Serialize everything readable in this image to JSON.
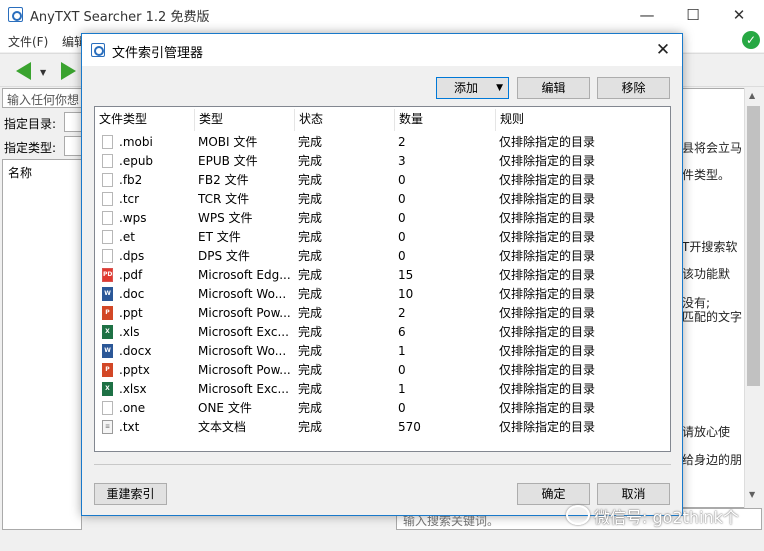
{
  "main": {
    "title": "AnyTXT Searcher 1.2 免费版",
    "window_buttons": [
      "—",
      "☐",
      "✕"
    ],
    "menu": [
      "文件(F)",
      "编辑"
    ],
    "search_placeholder": "输入任何你想",
    "dir_label": "指定目录:",
    "type_label": "指定类型:",
    "name_header": "名称",
    "right_snippets": [
      "县将会立马",
      "件类型。",
      "T开搜索软",
      "该功能默",
      "没有;",
      "匹配的文字",
      "请放心使",
      "给身边的朋"
    ],
    "bottom_input": "输入搜索关键词。",
    "status_icon": "check-icon"
  },
  "dialog": {
    "title": "文件索引管理器",
    "close_glyph": "✕",
    "add_label": "添加",
    "edit_label": "编辑",
    "remove_label": "移除",
    "rebuild_label": "重建索引",
    "ok_label": "确定",
    "cancel_label": "取消",
    "columns": [
      "文件类型",
      "类型",
      "状态",
      "数量",
      "规则"
    ],
    "rows": [
      {
        "ext": ".mobi",
        "type": "MOBI 文件",
        "status": "完成",
        "count": "2",
        "rule": "仅排除指定的目录",
        "icon": "blank"
      },
      {
        "ext": ".epub",
        "type": "EPUB 文件",
        "status": "完成",
        "count": "3",
        "rule": "仅排除指定的目录",
        "icon": "blank"
      },
      {
        "ext": ".fb2",
        "type": "FB2 文件",
        "status": "完成",
        "count": "0",
        "rule": "仅排除指定的目录",
        "icon": "blank"
      },
      {
        "ext": ".tcr",
        "type": "TCR 文件",
        "status": "完成",
        "count": "0",
        "rule": "仅排除指定的目录",
        "icon": "blank"
      },
      {
        "ext": ".wps",
        "type": "WPS 文件",
        "status": "完成",
        "count": "0",
        "rule": "仅排除指定的目录",
        "icon": "blank"
      },
      {
        "ext": ".et",
        "type": "ET 文件",
        "status": "完成",
        "count": "0",
        "rule": "仅排除指定的目录",
        "icon": "blank"
      },
      {
        "ext": ".dps",
        "type": "DPS 文件",
        "status": "完成",
        "count": "0",
        "rule": "仅排除指定的目录",
        "icon": "blank"
      },
      {
        "ext": ".pdf",
        "type": "Microsoft Edg...",
        "status": "完成",
        "count": "15",
        "rule": "仅排除指定的目录",
        "icon": "pdf"
      },
      {
        "ext": ".doc",
        "type": "Microsoft Wo...",
        "status": "完成",
        "count": "10",
        "rule": "仅排除指定的目录",
        "icon": "word"
      },
      {
        "ext": ".ppt",
        "type": "Microsoft Pow...",
        "status": "完成",
        "count": "2",
        "rule": "仅排除指定的目录",
        "icon": "ppt"
      },
      {
        "ext": ".xls",
        "type": "Microsoft Exc...",
        "status": "完成",
        "count": "6",
        "rule": "仅排除指定的目录",
        "icon": "xls"
      },
      {
        "ext": ".docx",
        "type": "Microsoft Wo...",
        "status": "完成",
        "count": "1",
        "rule": "仅排除指定的目录",
        "icon": "word"
      },
      {
        "ext": ".pptx",
        "type": "Microsoft Pow...",
        "status": "完成",
        "count": "0",
        "rule": "仅排除指定的目录",
        "icon": "ppt"
      },
      {
        "ext": ".xlsx",
        "type": "Microsoft Exc...",
        "status": "完成",
        "count": "1",
        "rule": "仅排除指定的目录",
        "icon": "xls"
      },
      {
        "ext": ".one",
        "type": "ONE 文件",
        "status": "完成",
        "count": "0",
        "rule": "仅排除指定的目录",
        "icon": "blank"
      },
      {
        "ext": ".txt",
        "type": "文本文档",
        "status": "完成",
        "count": "570",
        "rule": "仅排除指定的目录",
        "icon": "txt"
      }
    ]
  },
  "watermark": "微信号: go2think个"
}
